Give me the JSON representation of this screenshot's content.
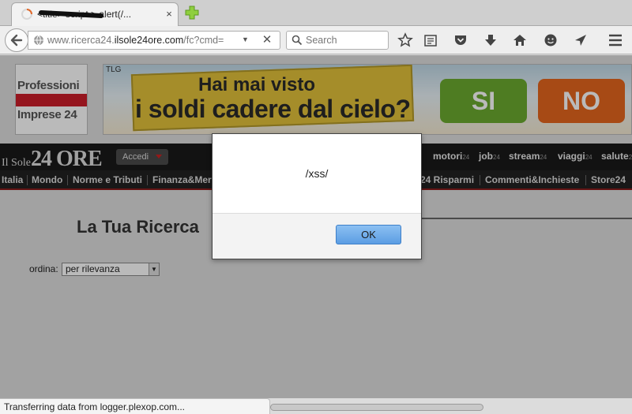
{
  "browser": {
    "tab": {
      "title": "<title> script > alert(/...",
      "close_glyph": "×"
    },
    "url": {
      "host_prefix": "www.ricerca24.",
      "host_domain": "ilsole24ore.com",
      "path": "/fc?cmd="
    },
    "search": {
      "placeholder": "Search"
    },
    "status": "Transferring data from logger.plexop.com..."
  },
  "header": {
    "logo": {
      "line1": "Professioni",
      "line2": "Imprese 24"
    },
    "banner": {
      "tag": "TLG",
      "line1": "Hai mai visto",
      "line2": "i soldi cadere dal cielo?",
      "yes": "SI",
      "no": "NO"
    },
    "masthead": {
      "logo_small": "Il Sole",
      "logo_big": "24 ORE",
      "login": "Accedi"
    },
    "top_nav": [
      {
        "name": "motori",
        "suffix": "24"
      },
      {
        "name": "job",
        "suffix": "24"
      },
      {
        "name": "stream",
        "suffix": "24"
      },
      {
        "name": "viaggi",
        "suffix": "24"
      },
      {
        "name": "salute",
        "suffix": "24"
      }
    ],
    "section_nav": [
      "Italia",
      "Mondo",
      "Norme e Tributi",
      "Finanza&Mercati",
      "24 Risparmi",
      "Commenti&Inchieste",
      "Store24"
    ]
  },
  "main": {
    "title": "La Tua Ricerca",
    "sort_label": "ordina:",
    "sort_value": "per rilevanza"
  },
  "dialog": {
    "message": "/xss/",
    "ok": "OK"
  },
  "colors": {
    "accent_red": "#cc1e2a",
    "ok_button": "#5b9de3",
    "banner_yes": "#6cab2f",
    "banner_no": "#e5661e"
  }
}
